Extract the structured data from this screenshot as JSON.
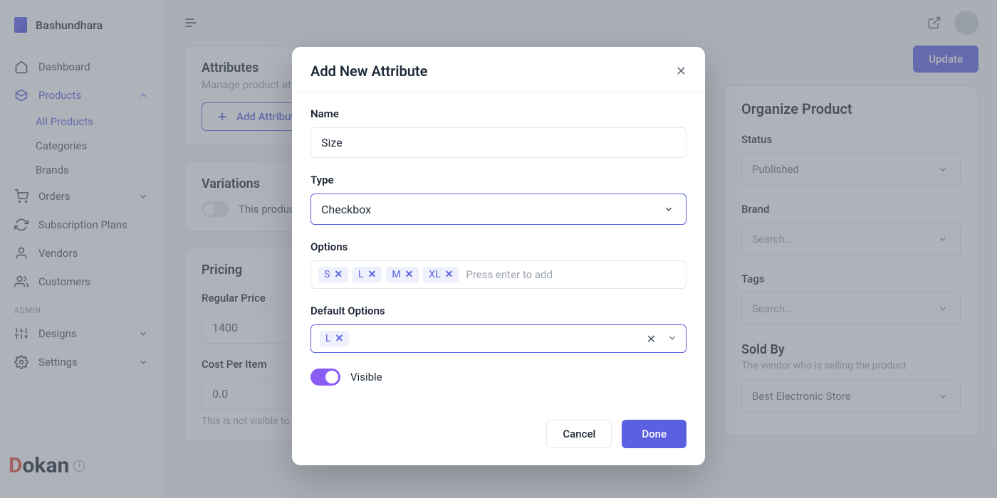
{
  "brand": {
    "name": "Bashundhara"
  },
  "sidebar": {
    "items": [
      {
        "label": "Dashboard"
      },
      {
        "label": "Products"
      },
      {
        "label": "Orders"
      },
      {
        "label": "Subscription Plans"
      },
      {
        "label": "Vendors"
      },
      {
        "label": "Customers"
      },
      {
        "label": "Designs"
      },
      {
        "label": "Settings"
      }
    ],
    "products_sub": [
      {
        "label": "All Products"
      },
      {
        "label": "Categories"
      },
      {
        "label": "Brands"
      }
    ],
    "admin_label": "ADMIN"
  },
  "footer_brand": "Dokan",
  "header": {
    "update_label": "Update"
  },
  "cards": {
    "attributes": {
      "title": "Attributes",
      "subtitle": "Manage product attributes",
      "add_btn": "Add Attribute"
    },
    "variations": {
      "title": "Variations",
      "text": "This product has variations"
    },
    "pricing": {
      "title": "Pricing",
      "regular_label": "Regular Price",
      "regular_value": "1400",
      "cost_label": "Cost Per Item",
      "cost_value": "0.0",
      "cost_hint": "This is not visible to customer"
    }
  },
  "organize": {
    "title": "Organize Product",
    "status_label": "Status",
    "status_value": "Published",
    "brand_label": "Brand",
    "brand_placeholder": "Search...",
    "tags_label": "Tags",
    "tags_placeholder": "Search...",
    "soldby_title": "Sold By",
    "soldby_sub": "The vendor who is selling the product",
    "soldby_value": "Best Electronic Store"
  },
  "modal": {
    "title": "Add New Attribute",
    "name_label": "Name",
    "name_value": "Size",
    "type_label": "Type",
    "type_value": "Checkbox",
    "options_label": "Options",
    "options": [
      "S",
      "L",
      "M",
      "XL"
    ],
    "options_placeholder": "Press enter to add",
    "default_label": "Default Options",
    "default_options": [
      "L"
    ],
    "visible_label": "Visible",
    "cancel": "Cancel",
    "done": "Done"
  }
}
